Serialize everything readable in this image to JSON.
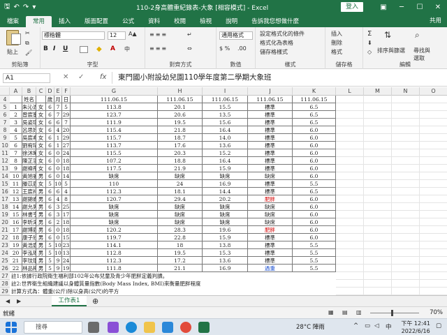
{
  "window": {
    "title": "110-2身高體重紀錄表-大象 [相容模式] - Excel",
    "login": "登入"
  },
  "tabs": [
    "檔案",
    "常用",
    "插入",
    "版面配置",
    "公式",
    "資料",
    "校閱",
    "檢視",
    "說明"
  ],
  "tell_me": "告訴我您想做什麼",
  "share": "共用",
  "ribbon": {
    "clipboard": "剪貼簿",
    "paste": "貼上",
    "font_group": "字型",
    "font_name": "標楷體",
    "font_size": "12",
    "alignment_group": "對齊方式",
    "number_group": "數值",
    "number_format": "通用格式",
    "styles_group": "樣式",
    "cond_format": "設定格式化的條件",
    "format_table": "格式化為表格",
    "cell_styles": "儲存格樣式",
    "cells_group": "儲存格",
    "insert": "插入",
    "delete": "刪除",
    "format": "格式",
    "editing_group": "編輯",
    "sort_filter": "排序與篩選",
    "find_select": "尋找與選取"
  },
  "formula_bar": {
    "name_box": "A1",
    "content": "東門國小附設幼兒園110學年度第二學期大象班"
  },
  "columns": [
    "A",
    "B",
    "C",
    "D",
    "E",
    "F",
    "G",
    "H",
    "I",
    "J",
    "K",
    "L",
    "M",
    "N",
    "O",
    "P",
    "Q",
    "R",
    "S",
    "T"
  ],
  "header_row": {
    "row": "4",
    "b": "姓名",
    "d": "歲",
    "e": "月",
    "f": "日",
    "dates": [
      "111.06.15",
      "111.06.15",
      "111.06.15",
      "111.06.15",
      "111.06.15"
    ]
  },
  "rows": [
    {
      "r": "5",
      "n": "1",
      "name": "朱沁渝",
      "sex": "女",
      "y": "6",
      "m": "7",
      "d": "5",
      "h": "113.8",
      "w": "20.1",
      "bmi": "15.5",
      "s": "標準",
      "v": "6.5",
      "sc": ""
    },
    {
      "r": "6",
      "n": "2",
      "name": "曾宸蜜",
      "sex": "女",
      "y": "6",
      "m": "7",
      "d": "29",
      "h": "123.7",
      "w": "20.6",
      "bmi": "13.5",
      "s": "標準",
      "v": "6.5",
      "sc": ""
    },
    {
      "r": "7",
      "n": "3",
      "name": "吳姿琪",
      "sex": "女",
      "y": "6",
      "m": "6",
      "d": "7",
      "h": "111.9",
      "w": "19.5",
      "bmi": "15.6",
      "s": "標準",
      "v": "6.5",
      "sc": ""
    },
    {
      "r": "8",
      "n": "4",
      "name": "呂思妤",
      "sex": "女",
      "y": "6",
      "m": "4",
      "d": "20",
      "h": "115.4",
      "w": "21.8",
      "bmi": "16.4",
      "s": "標準",
      "v": "6.0",
      "sc": ""
    },
    {
      "r": "9",
      "n": "5",
      "name": "吳宸希",
      "sex": "女",
      "y": "6",
      "m": "1",
      "d": "29",
      "h": "115.7",
      "w": "18.7",
      "bmi": "14.0",
      "s": "標準",
      "v": "6.0",
      "sc": ""
    },
    {
      "r": "10",
      "n": "6",
      "name": "劉宥琦",
      "sex": "女",
      "y": "6",
      "m": "1",
      "d": "27",
      "h": "113.7",
      "w": "17.6",
      "bmi": "13.6",
      "s": "標準",
      "v": "6.0",
      "sc": ""
    },
    {
      "r": "11",
      "n": "7",
      "name": "徐沐晞",
      "sex": "女",
      "y": "6",
      "m": "0",
      "d": "24",
      "h": "115.5",
      "w": "20.3",
      "bmi": "15.2",
      "s": "標準",
      "v": "6.0",
      "sc": ""
    },
    {
      "r": "12",
      "n": "8",
      "name": "陳芷羽",
      "sex": "女",
      "y": "6",
      "m": "0",
      "d": "18",
      "h": "107.2",
      "w": "18.8",
      "bmi": "16.4",
      "s": "標準",
      "v": "6.0",
      "sc": ""
    },
    {
      "r": "13",
      "n": "9",
      "name": "謝禕彤",
      "sex": "女",
      "y": "6",
      "m": "0",
      "d": "18",
      "h": "117.5",
      "w": "21.9",
      "bmi": "15.9",
      "s": "標準",
      "v": "6.0",
      "sc": ""
    },
    {
      "r": "14",
      "n": "10",
      "name": "黃旭晏",
      "sex": "男",
      "y": "6",
      "m": "0",
      "d": "14",
      "h": "缺席",
      "w": "缺席",
      "bmi": "缺席",
      "s": "缺席",
      "v": "6.0",
      "sc": ""
    },
    {
      "r": "15",
      "n": "11",
      "name": "滕苡辰",
      "sex": "女",
      "y": "5",
      "m": "10",
      "d": "5",
      "h": "110",
      "w": "24",
      "bmi": "16.9",
      "s": "標準",
      "v": "5.5",
      "sc": ""
    },
    {
      "r": "16",
      "n": "12",
      "name": "王宸祥",
      "sex": "男",
      "y": "6",
      "m": "6",
      "d": "4",
      "h": "112.3",
      "w": "18.1",
      "bmi": "14.4",
      "s": "標準",
      "v": "6.5",
      "sc": ""
    },
    {
      "r": "17",
      "n": "13",
      "name": "謝錦崙",
      "sex": "男",
      "y": "6",
      "m": "4",
      "d": "8",
      "h": "120.7",
      "w": "29.4",
      "bmi": "20.2",
      "s": "肥胖",
      "v": "6.0",
      "sc": "red"
    },
    {
      "r": "18",
      "n": "14",
      "name": "謝允晃",
      "sex": "男",
      "y": "6",
      "m": "3",
      "d": "25",
      "h": "缺席",
      "w": "缺席",
      "bmi": "缺席",
      "s": "缺席",
      "v": "6.0",
      "sc": ""
    },
    {
      "r": "19",
      "n": "15",
      "name": "林書亨",
      "sex": "男",
      "y": "6",
      "m": "3",
      "d": "17",
      "h": "缺席",
      "w": "缺席",
      "bmi": "缺席",
      "s": "缺席",
      "v": "6.0",
      "sc": ""
    },
    {
      "r": "20",
      "n": "16",
      "name": "李昕澤",
      "sex": "男",
      "y": "6",
      "m": "2",
      "d": "18",
      "h": "缺席",
      "w": "缺席",
      "bmi": "缺席",
      "s": "缺席",
      "v": "6.0",
      "sc": ""
    },
    {
      "r": "21",
      "n": "17",
      "name": "謝博辰",
      "sex": "男",
      "y": "6",
      "m": "0",
      "d": "18",
      "h": "120.2",
      "w": "28.3",
      "bmi": "19.6",
      "s": "肥胖",
      "v": "6.0",
      "sc": "red"
    },
    {
      "r": "22",
      "n": "18",
      "name": "康子欣",
      "sex": "男",
      "y": "6",
      "m": "0",
      "d": "15",
      "h": "119.7",
      "w": "22.8",
      "bmi": "15.9",
      "s": "標準",
      "v": "6.0",
      "sc": ""
    },
    {
      "r": "23",
      "n": "19",
      "name": "黃浩宸",
      "sex": "男",
      "y": "5",
      "m": "10",
      "d": "23",
      "h": "114.1",
      "w": "18",
      "bmi": "13.8",
      "s": "標準",
      "v": "5.5",
      "sc": ""
    },
    {
      "r": "24",
      "n": "20",
      "name": "李泓瑀",
      "sex": "男",
      "y": "5",
      "m": "10",
      "d": "13",
      "h": "112.8",
      "w": "19.5",
      "bmi": "15.3",
      "s": "標準",
      "v": "5.5",
      "sc": ""
    },
    {
      "r": "25",
      "n": "21",
      "name": "李玟琨",
      "sex": "男",
      "y": "5",
      "m": "9",
      "d": "24",
      "h": "112.3",
      "w": "17.2",
      "bmi": "13.6",
      "s": "標準",
      "v": "5.5",
      "sc": ""
    },
    {
      "r": "26",
      "n": "22",
      "name": "林品樺",
      "sex": "男",
      "y": "5",
      "m": "9",
      "d": "19",
      "h": "111.8",
      "w": "21.1",
      "bmi": "16.9",
      "s": "過重",
      "v": "5.5",
      "sc": "blue"
    }
  ],
  "notes": [
    {
      "r": "27",
      "text": "註1:依據行政院衛生福利部102年公布兒童及青少年肥胖定義判讀。"
    },
    {
      "r": "28",
      "text": "註2:世界衛生組織建議以身體質量指數(Body Mass Index, BMI)來衡量肥胖程度"
    },
    {
      "r": "29",
      "text": "      計算方式為：體重(公斤)除以身高(公尺)的平方"
    }
  ],
  "sheet_tab": "工作表1",
  "status": {
    "ready": "就緒",
    "zoom": "70%"
  },
  "taskbar": {
    "search": "搜尋",
    "weather": "28°C 陣雨",
    "lang": "中",
    "time": "下午 12:41",
    "date": "2022/6/16"
  }
}
